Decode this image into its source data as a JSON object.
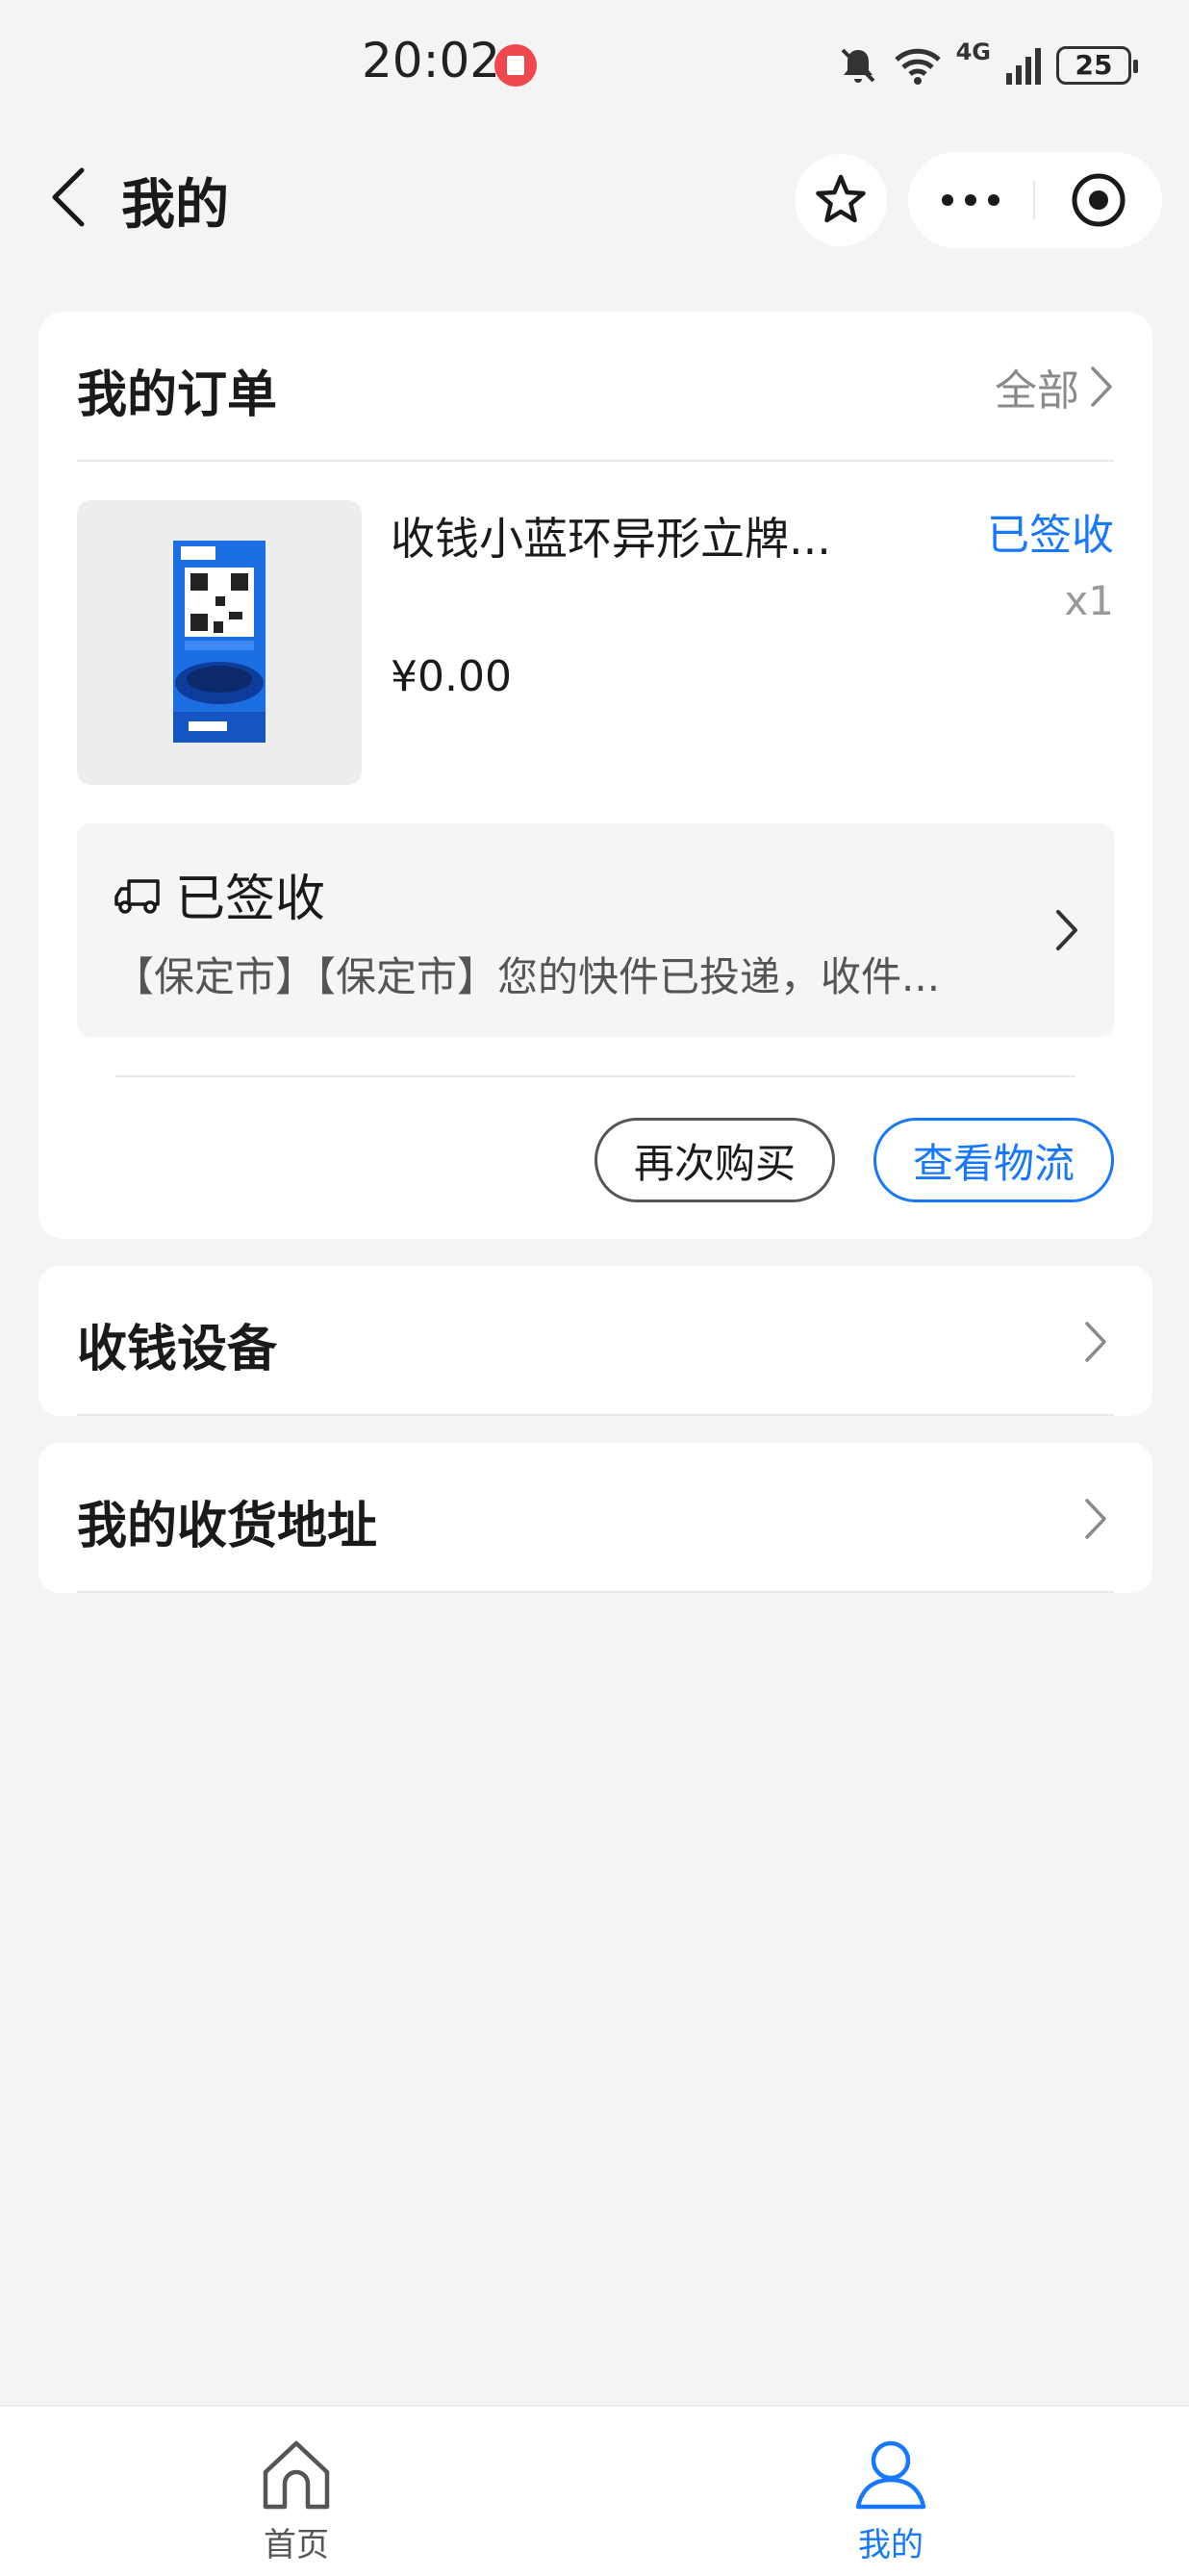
{
  "status_bar": {
    "time": "20:02",
    "network": "4G",
    "battery": "25"
  },
  "nav": {
    "title": "我的",
    "icons": [
      "back-icon",
      "star-icon",
      "more-icon",
      "close-target-icon"
    ]
  },
  "orders": {
    "title": "我的订单",
    "view_all": "全部",
    "item": {
      "name": "收钱小蓝环异形立牌...",
      "status": "已签收",
      "quantity": "x1",
      "price": "¥0.00"
    },
    "logistics": {
      "status": "已签收",
      "detail": "【保定市】【保定市】您的快件已投递，收件..."
    },
    "buttons": {
      "rebuy": "再次购买",
      "track": "查看物流"
    }
  },
  "menu": {
    "devices": "收钱设备",
    "addresses": "我的收货地址"
  },
  "tab_bar": {
    "home": "首页",
    "mine": "我的"
  },
  "colors": {
    "accent": "#1677ff",
    "background": "#f4f4f5",
    "record_badge": "#f0464d"
  }
}
